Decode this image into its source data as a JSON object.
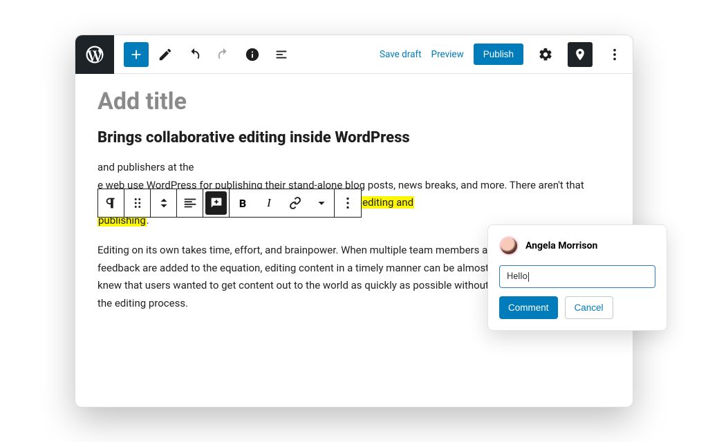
{
  "topbar": {
    "save_draft": "Save draft",
    "preview": "Preview",
    "publish": "Publish"
  },
  "editor": {
    "title_placeholder": "Add title",
    "heading": "Brings collaborative editing inside WordPress",
    "para1_tail": " and publishers at the",
    "para1_line2_tail": "e web use WordPress",
    "para1_rest": "for publishing their stand-alone blog posts, news breaks, and more. There aren't that many great tools available in WordPress for ",
    "highlight1": "collaborative editing and",
    "highlight2": "publishing",
    "para1_end": ".",
    "para2": "Editing on its own takes time, effort, and brainpower. When multiple team members and their constant feedback are added to the equation, editing content in a timely manner can be almost impossible to do. We knew that users wanted to get content out to the world as quickly as possible without having to spend eons on the editing process."
  },
  "toolbar": {
    "bold": "B",
    "italic": "I"
  },
  "comment": {
    "author": "Angela Morrison",
    "input_value": "Hello",
    "submit": "Comment",
    "cancel": "Cancel"
  }
}
